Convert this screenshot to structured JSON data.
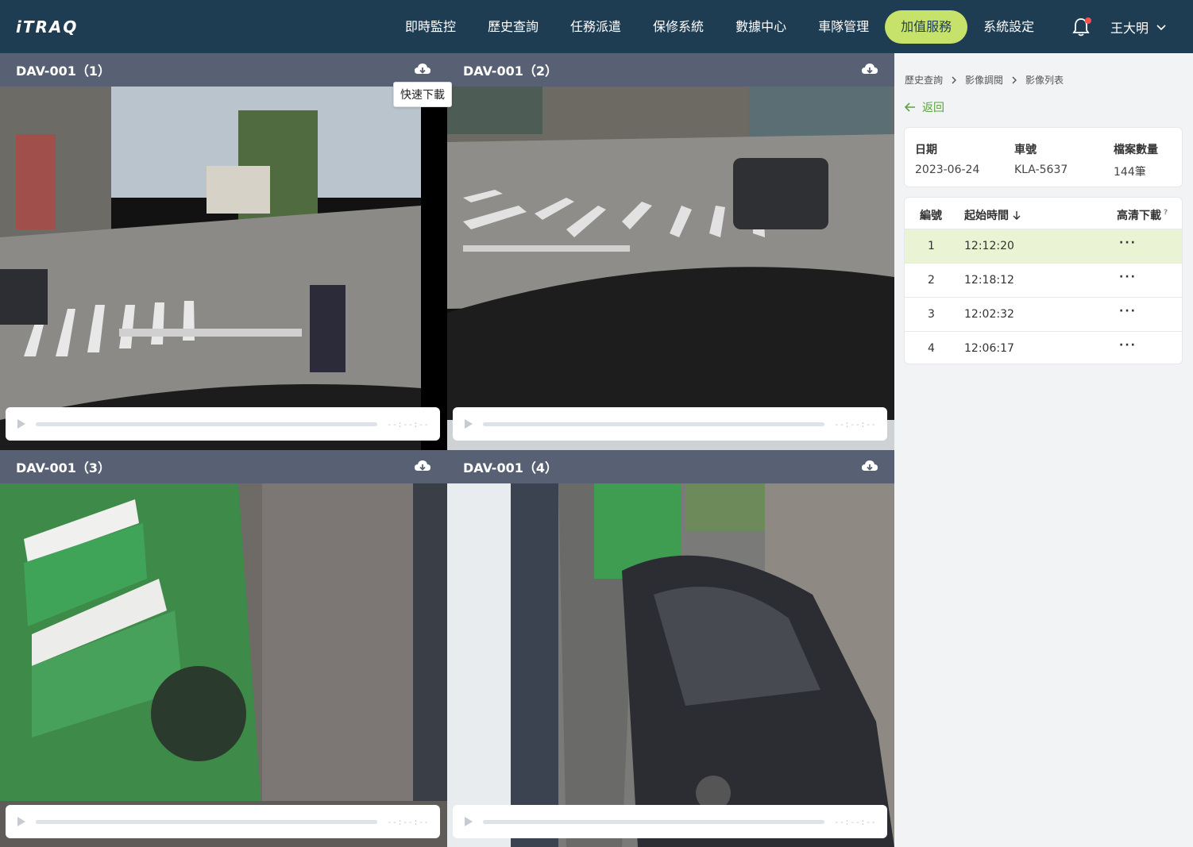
{
  "header": {
    "logo": "iTRAQ",
    "nav": [
      "即時監控",
      "歷史查詢",
      "任務派遣",
      "保修系統",
      "數據中心",
      "車隊管理",
      "加值服務",
      "系統設定"
    ],
    "active_index": 6,
    "user_name": "王大明",
    "colors": {
      "bar": "#1f3d52",
      "active": "#c6e26a",
      "notification": "#ff4d4f"
    }
  },
  "videos": [
    {
      "title": "DAV-001（1）",
      "time": "--:--:--"
    },
    {
      "title": "DAV-001（2）",
      "time": "--:--:--"
    },
    {
      "title": "DAV-001（3）",
      "time": "--:--:--"
    },
    {
      "title": "DAV-001（4）",
      "time": "--:--:--"
    }
  ],
  "tooltip": "快速下載",
  "panel": {
    "breadcrumb": [
      "歷史查詢",
      "影像調閱",
      "影像列表"
    ],
    "back_label": "返回",
    "info": {
      "date_label": "日期",
      "date_value": "2023-06-24",
      "plate_label": "車號",
      "plate_value": "KLA-5637",
      "count_label": "檔案數量",
      "count_value": "144筆"
    },
    "table": {
      "col_no": "編號",
      "col_time": "起始時間",
      "col_download": "高清下載",
      "rows": [
        {
          "no": "1",
          "time": "12:12:20",
          "more": "···"
        },
        {
          "no": "2",
          "time": "12:18:12",
          "more": "···"
        },
        {
          "no": "3",
          "time": "12:02:32",
          "more": "···"
        },
        {
          "no": "4",
          "time": "12:06:17",
          "more": "···"
        }
      ],
      "selected_index": 0
    }
  }
}
